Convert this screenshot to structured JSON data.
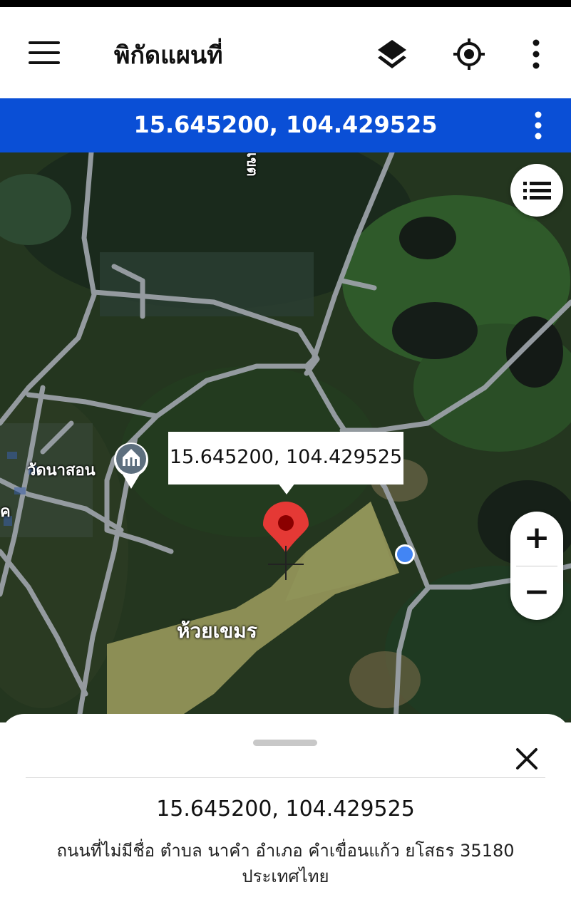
{
  "app": {
    "title": "พิกัดแผนที่"
  },
  "icons": {
    "menu": "menu-icon",
    "layers": "layers-icon",
    "locate": "my-location-icon",
    "more": "more-vert-icon",
    "list": "list-icon",
    "pin": "map-pin-icon",
    "temple": "temple-icon",
    "close": "close-icon"
  },
  "coord_bar": {
    "coordinates": "15.645200, 104.429525"
  },
  "map": {
    "callout": "15.645200, 104.429525",
    "labels": {
      "temple": "วัดนาสอน",
      "area": "ห้วยเขมร",
      "road_fragment": "เขต",
      "edge_fragment": "ค"
    },
    "zoom_in": "+",
    "zoom_out": "−"
  },
  "sheet": {
    "coordinates": "15.645200, 104.429525",
    "address_line1": "ถนนที่ไม่มีชื่อ ตำบล นาคำ อำเภอ คำเขื่อนแก้ว ยโสธร 35180",
    "address_line2": "ประเทศไทย"
  },
  "colors": {
    "coord_bar": "#0a4fd6",
    "pin": "#e53935",
    "location_dot": "#4285f4"
  }
}
